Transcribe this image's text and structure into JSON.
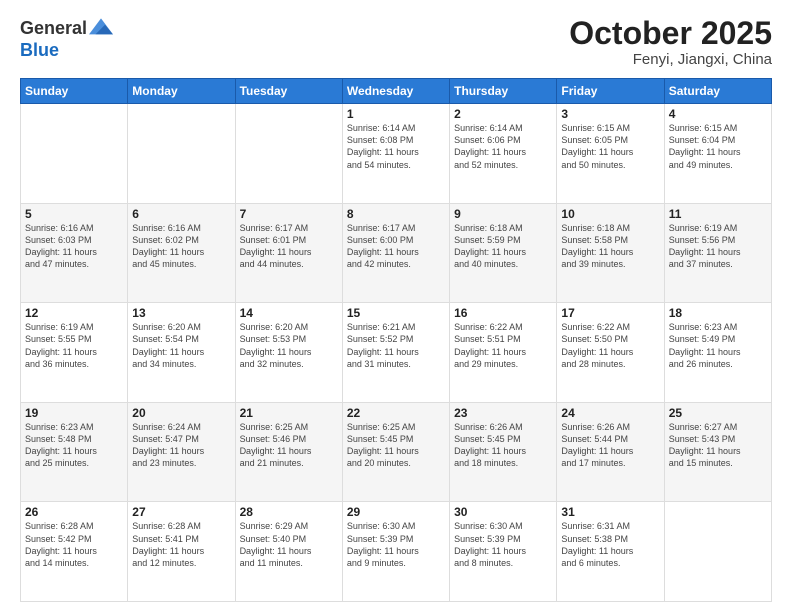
{
  "header": {
    "logo_line1": "General",
    "logo_line2": "Blue",
    "title": "October 2025",
    "subtitle": "Fenyi, Jiangxi, China"
  },
  "weekdays": [
    "Sunday",
    "Monday",
    "Tuesday",
    "Wednesday",
    "Thursday",
    "Friday",
    "Saturday"
  ],
  "weeks": [
    [
      {
        "day": "",
        "info": ""
      },
      {
        "day": "",
        "info": ""
      },
      {
        "day": "",
        "info": ""
      },
      {
        "day": "1",
        "info": "Sunrise: 6:14 AM\nSunset: 6:08 PM\nDaylight: 11 hours\nand 54 minutes."
      },
      {
        "day": "2",
        "info": "Sunrise: 6:14 AM\nSunset: 6:06 PM\nDaylight: 11 hours\nand 52 minutes."
      },
      {
        "day": "3",
        "info": "Sunrise: 6:15 AM\nSunset: 6:05 PM\nDaylight: 11 hours\nand 50 minutes."
      },
      {
        "day": "4",
        "info": "Sunrise: 6:15 AM\nSunset: 6:04 PM\nDaylight: 11 hours\nand 49 minutes."
      }
    ],
    [
      {
        "day": "5",
        "info": "Sunrise: 6:16 AM\nSunset: 6:03 PM\nDaylight: 11 hours\nand 47 minutes."
      },
      {
        "day": "6",
        "info": "Sunrise: 6:16 AM\nSunset: 6:02 PM\nDaylight: 11 hours\nand 45 minutes."
      },
      {
        "day": "7",
        "info": "Sunrise: 6:17 AM\nSunset: 6:01 PM\nDaylight: 11 hours\nand 44 minutes."
      },
      {
        "day": "8",
        "info": "Sunrise: 6:17 AM\nSunset: 6:00 PM\nDaylight: 11 hours\nand 42 minutes."
      },
      {
        "day": "9",
        "info": "Sunrise: 6:18 AM\nSunset: 5:59 PM\nDaylight: 11 hours\nand 40 minutes."
      },
      {
        "day": "10",
        "info": "Sunrise: 6:18 AM\nSunset: 5:58 PM\nDaylight: 11 hours\nand 39 minutes."
      },
      {
        "day": "11",
        "info": "Sunrise: 6:19 AM\nSunset: 5:56 PM\nDaylight: 11 hours\nand 37 minutes."
      }
    ],
    [
      {
        "day": "12",
        "info": "Sunrise: 6:19 AM\nSunset: 5:55 PM\nDaylight: 11 hours\nand 36 minutes."
      },
      {
        "day": "13",
        "info": "Sunrise: 6:20 AM\nSunset: 5:54 PM\nDaylight: 11 hours\nand 34 minutes."
      },
      {
        "day": "14",
        "info": "Sunrise: 6:20 AM\nSunset: 5:53 PM\nDaylight: 11 hours\nand 32 minutes."
      },
      {
        "day": "15",
        "info": "Sunrise: 6:21 AM\nSunset: 5:52 PM\nDaylight: 11 hours\nand 31 minutes."
      },
      {
        "day": "16",
        "info": "Sunrise: 6:22 AM\nSunset: 5:51 PM\nDaylight: 11 hours\nand 29 minutes."
      },
      {
        "day": "17",
        "info": "Sunrise: 6:22 AM\nSunset: 5:50 PM\nDaylight: 11 hours\nand 28 minutes."
      },
      {
        "day": "18",
        "info": "Sunrise: 6:23 AM\nSunset: 5:49 PM\nDaylight: 11 hours\nand 26 minutes."
      }
    ],
    [
      {
        "day": "19",
        "info": "Sunrise: 6:23 AM\nSunset: 5:48 PM\nDaylight: 11 hours\nand 25 minutes."
      },
      {
        "day": "20",
        "info": "Sunrise: 6:24 AM\nSunset: 5:47 PM\nDaylight: 11 hours\nand 23 minutes."
      },
      {
        "day": "21",
        "info": "Sunrise: 6:25 AM\nSunset: 5:46 PM\nDaylight: 11 hours\nand 21 minutes."
      },
      {
        "day": "22",
        "info": "Sunrise: 6:25 AM\nSunset: 5:45 PM\nDaylight: 11 hours\nand 20 minutes."
      },
      {
        "day": "23",
        "info": "Sunrise: 6:26 AM\nSunset: 5:45 PM\nDaylight: 11 hours\nand 18 minutes."
      },
      {
        "day": "24",
        "info": "Sunrise: 6:26 AM\nSunset: 5:44 PM\nDaylight: 11 hours\nand 17 minutes."
      },
      {
        "day": "25",
        "info": "Sunrise: 6:27 AM\nSunset: 5:43 PM\nDaylight: 11 hours\nand 15 minutes."
      }
    ],
    [
      {
        "day": "26",
        "info": "Sunrise: 6:28 AM\nSunset: 5:42 PM\nDaylight: 11 hours\nand 14 minutes."
      },
      {
        "day": "27",
        "info": "Sunrise: 6:28 AM\nSunset: 5:41 PM\nDaylight: 11 hours\nand 12 minutes."
      },
      {
        "day": "28",
        "info": "Sunrise: 6:29 AM\nSunset: 5:40 PM\nDaylight: 11 hours\nand 11 minutes."
      },
      {
        "day": "29",
        "info": "Sunrise: 6:30 AM\nSunset: 5:39 PM\nDaylight: 11 hours\nand 9 minutes."
      },
      {
        "day": "30",
        "info": "Sunrise: 6:30 AM\nSunset: 5:39 PM\nDaylight: 11 hours\nand 8 minutes."
      },
      {
        "day": "31",
        "info": "Sunrise: 6:31 AM\nSunset: 5:38 PM\nDaylight: 11 hours\nand 6 minutes."
      },
      {
        "day": "",
        "info": ""
      }
    ]
  ]
}
